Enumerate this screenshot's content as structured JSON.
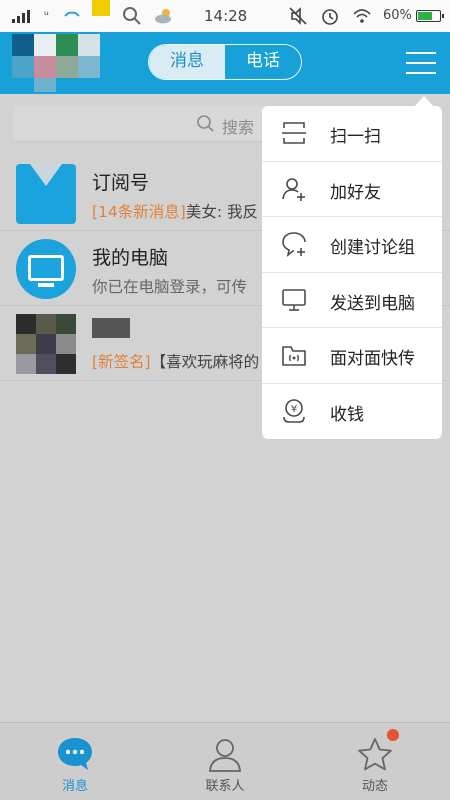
{
  "status_bar": {
    "carrier": "ᵘ",
    "time": "14:28",
    "battery_text": "60%"
  },
  "header": {
    "tabs": [
      "消息",
      "电话"
    ],
    "active_tab": "消息"
  },
  "search": {
    "placeholder": "搜索"
  },
  "conversations": [
    {
      "title": "订阅号",
      "tag": "[14条新消息]",
      "preview": "美女: 我反"
    },
    {
      "title": "我的电脑",
      "tag": "",
      "preview": "你已在电脑登录，可传"
    },
    {
      "title": "",
      "tag": "[新签名]",
      "preview": "【喜欢玩麻将的"
    }
  ],
  "popup_menu": {
    "items": [
      {
        "label": "扫一扫",
        "icon": "scan-icon"
      },
      {
        "label": "加好友",
        "icon": "add-friend-icon"
      },
      {
        "label": "创建讨论组",
        "icon": "create-discussion-icon"
      },
      {
        "label": "发送到电脑",
        "icon": "send-to-computer-icon"
      },
      {
        "label": "面对面快传",
        "icon": "face-to-face-transfer-icon"
      },
      {
        "label": "收钱",
        "icon": "receive-money-icon"
      }
    ]
  },
  "tabbar": {
    "tabs": [
      {
        "label": "消息",
        "icon": "chat-bubble-icon",
        "active": true
      },
      {
        "label": "联系人",
        "icon": "contacts-icon",
        "active": false
      },
      {
        "label": "动态",
        "icon": "star-icon",
        "active": false,
        "badge": true
      }
    ]
  },
  "colors": {
    "accent": "#18a0d8",
    "tag": "#e0823a",
    "badge": "#e55234"
  }
}
